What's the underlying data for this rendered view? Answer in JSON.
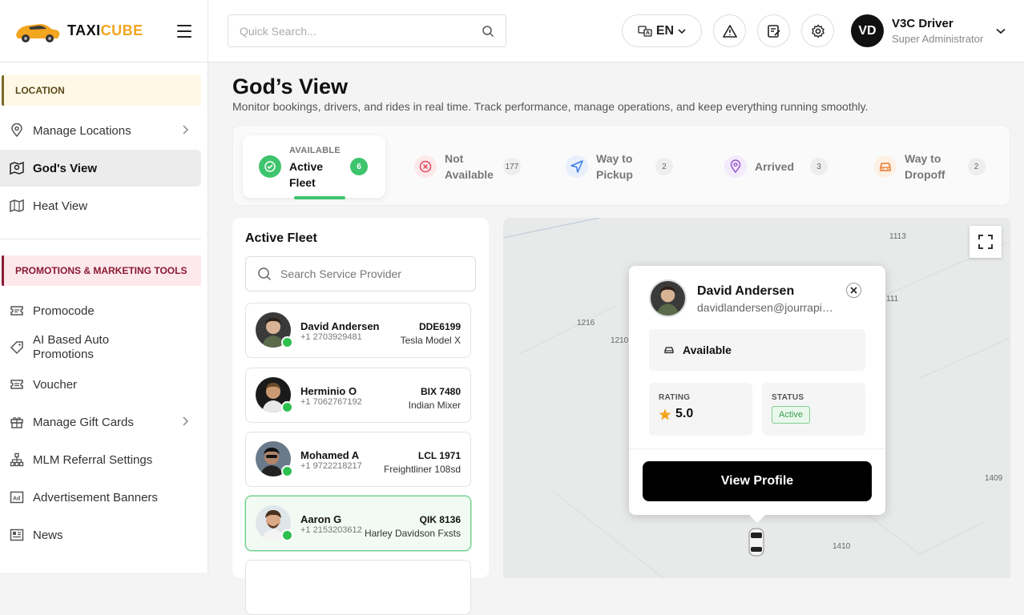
{
  "brand": {
    "logo_text_a": "TAXI",
    "logo_text_b": "CUBE",
    "accent": "#f2a51f"
  },
  "sidebar": {
    "location_section": "LOCATION",
    "location_items": [
      {
        "label": "Manage Locations",
        "icon": "map-pin-icon",
        "has_chevron": true
      },
      {
        "label": "God's View",
        "icon": "map-view-icon",
        "active": true
      },
      {
        "label": "Heat View",
        "icon": "heat-map-icon"
      }
    ],
    "promo_section": "PROMOTIONS & MARKETING TOOLS",
    "promo_items": [
      {
        "label": "Promocode",
        "icon": "ticket-icon"
      },
      {
        "label": "AI Based Auto Promotions",
        "icon": "tag-icon"
      },
      {
        "label": "Voucher",
        "icon": "voucher-icon"
      },
      {
        "label": "Manage Gift Cards",
        "icon": "gift-icon",
        "has_chevron": true
      },
      {
        "label": "MLM Referral Settings",
        "icon": "hierarchy-icon"
      },
      {
        "label": "Advertisement Banners",
        "icon": "ad-icon"
      },
      {
        "label": "News",
        "icon": "news-icon"
      }
    ]
  },
  "topbar": {
    "search_placeholder": "Quick Search...",
    "language": "EN",
    "user": {
      "initials": "VD",
      "name": "V3C Driver",
      "role": "Super Administrator"
    }
  },
  "page": {
    "title": "God’s View",
    "subtitle": "Monitor bookings, drivers, and rides in real time. Track performance, manage operations, and keep everything running smoothly."
  },
  "status_tabs": [
    {
      "overline": "AVAILABLE",
      "label_line1": "Active",
      "label_line2": "Fleet",
      "count": "6",
      "active": true,
      "color": "#3ec46d"
    },
    {
      "label_line1": "Not",
      "label_line2": "Available",
      "count": "177",
      "color": "#e0455a"
    },
    {
      "label_line1": "Way to",
      "label_line2": "Pickup",
      "count": "2",
      "color": "#3b7be0"
    },
    {
      "label_line1": "Arrived",
      "count": "3",
      "color": "#9a5ad0"
    },
    {
      "label_line1": "Way to",
      "label_line2": "Dropoff",
      "count": "2",
      "color": "#e8782a"
    }
  ],
  "fleet": {
    "title": "Active Fleet",
    "search_placeholder": "Search Service Provider",
    "drivers": [
      {
        "name": "David Andersen",
        "phone": "+1 2703929481",
        "plate": "DDE6199",
        "vehicle": "Tesla Model X"
      },
      {
        "name": "Herminio O",
        "phone": "+1 7062767192",
        "plate": "BIX 7480",
        "vehicle": "Indian Mixer"
      },
      {
        "name": "Mohamed A",
        "phone": "+1 9722218217",
        "plate": "LCL 1971",
        "vehicle": "Freightliner 108sd"
      },
      {
        "name": "Aaron G",
        "phone": "+1 2153203612",
        "plate": "QIK 8136",
        "vehicle": "Harley Davidson Fxsts",
        "selected": true
      }
    ]
  },
  "map": {
    "labels": [
      "1113",
      "111",
      "1216",
      "1210",
      "1409",
      "1410"
    ]
  },
  "popup": {
    "name": "David Andersen",
    "email": "davidlandersen@jourrapide.com",
    "availability": "Available",
    "rating_label": "RATING",
    "rating_value": "5.0",
    "status_label": "STATUS",
    "status_value": "Active",
    "button": "View Profile"
  }
}
